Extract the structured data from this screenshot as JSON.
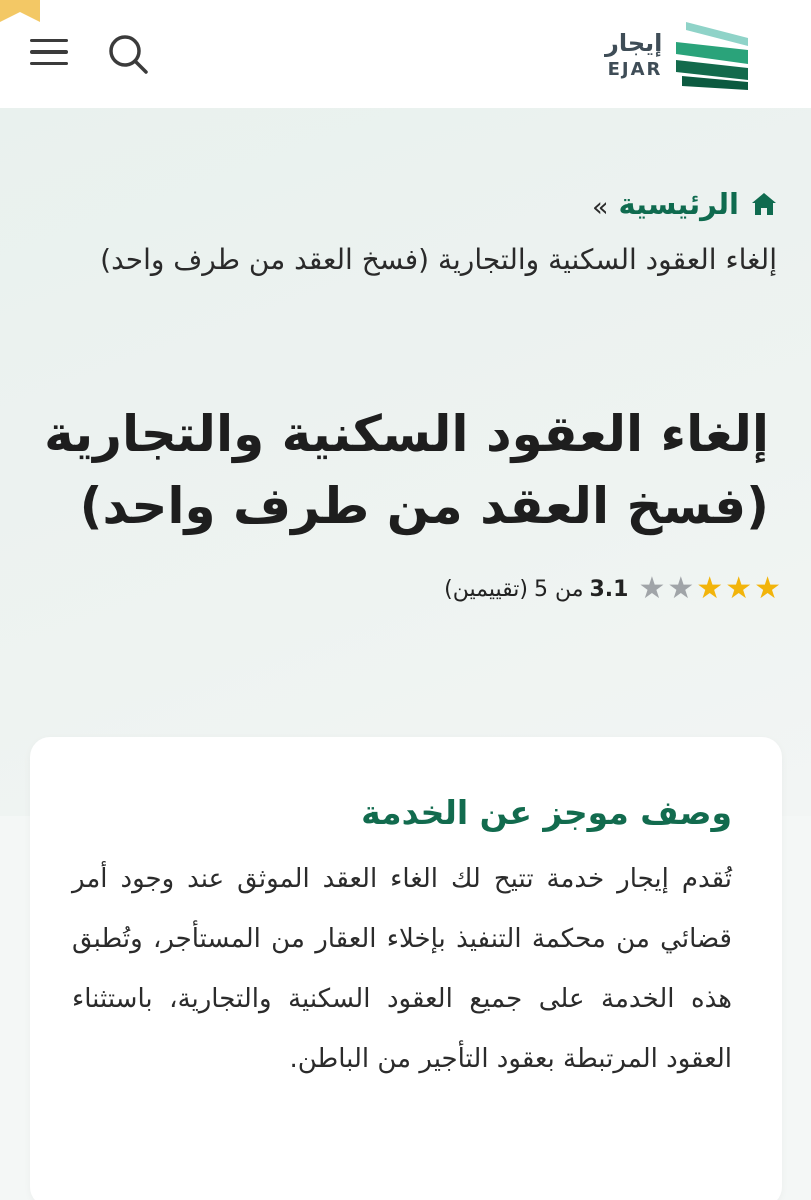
{
  "header": {
    "logo": {
      "arabic": "إيجار",
      "english": "EJAR"
    },
    "menu_icon": "hamburger-menu-icon",
    "search_icon": "search-icon"
  },
  "breadcrumb": {
    "home_label": "الرئيسية",
    "separator": "»",
    "current": "إلغاء العقود السكنية والتجارية (فسخ العقد من طرف واحد)"
  },
  "page": {
    "title": "إلغاء العقود السكنية والتجارية (فسخ العقد من طرف واحد)"
  },
  "rating": {
    "value": "3.1",
    "out_of_text": "من 5",
    "count_text": "(تقييمين)",
    "stars_filled": 3,
    "stars_total": 5
  },
  "service_card": {
    "title": "وصف موجز عن الخدمة",
    "description": "تُقدم إيجار خدمة تتيح لك الغاء العقد الموثق عند وجود أمر قضائي من محكمة التنفيذ بإخلاء العقار من المستأجر، وتُطبق هذه الخدمة على جميع العقود السكنية والتجارية، باستثناء العقود المرتبطة بعقود التأجير من الباطن."
  },
  "colors": {
    "brand_green": "#126b4e",
    "star_gold": "#f2b40b",
    "star_gray": "#a0a4a8",
    "logo_gray": "#3f4d57"
  }
}
